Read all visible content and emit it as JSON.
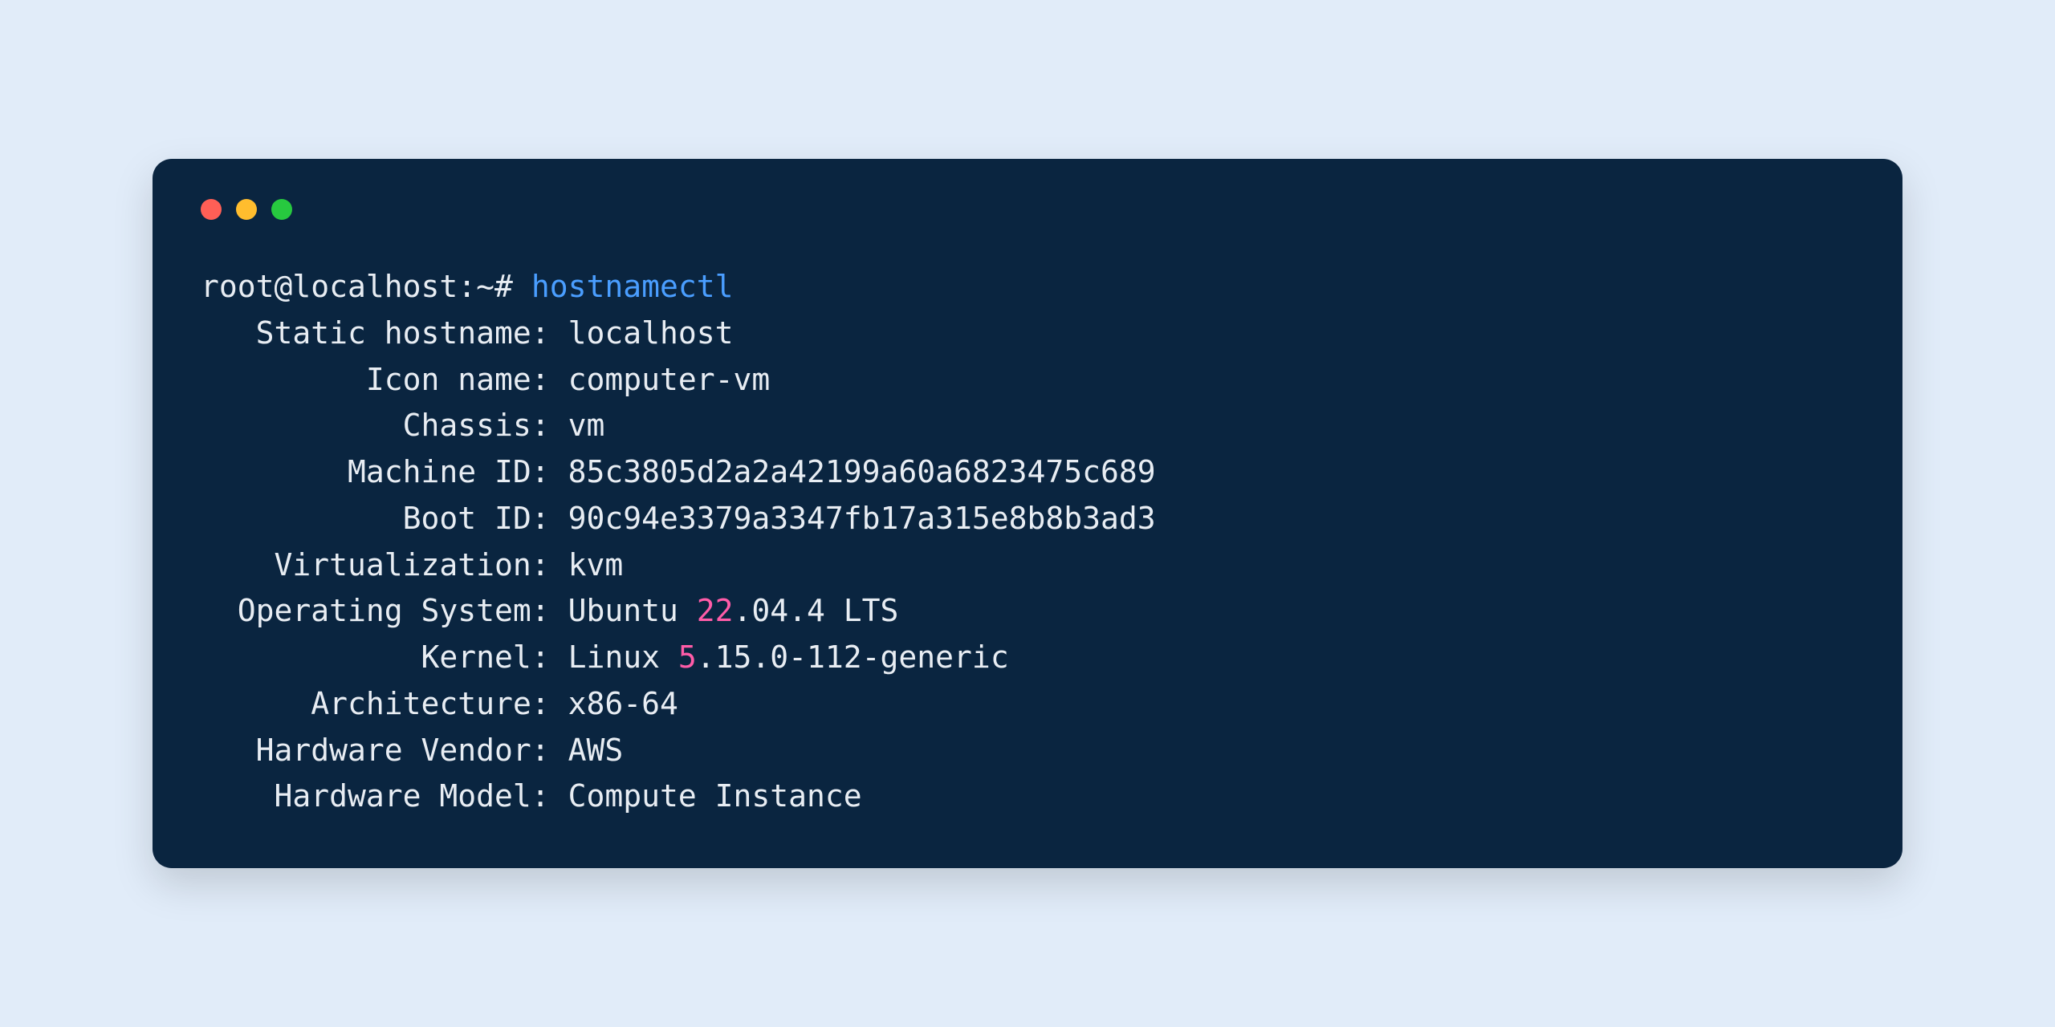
{
  "colors": {
    "background": "#e1ecf9",
    "terminal": "#0a2540",
    "text": "#e8edf3",
    "command": "#4a9eff",
    "highlight": "#ff5ca8",
    "traffic_red": "#ff5f56",
    "traffic_yellow": "#ffbd2e",
    "traffic_green": "#27c93f"
  },
  "prompt": "root@localhost:~#",
  "command": "hostnamectl",
  "rows": {
    "static_hostname": {
      "label": "Static hostname:",
      "value": "localhost"
    },
    "icon_name": {
      "label": "Icon name:",
      "value": "computer-vm"
    },
    "chassis": {
      "label": "Chassis:",
      "value": "vm"
    },
    "machine_id": {
      "label": "Machine ID:",
      "value": "85c3805d2a2a42199a60a6823475c689"
    },
    "boot_id": {
      "label": "Boot ID:",
      "value": "90c94e3379a3347fb17a315e8b8b3ad3"
    },
    "virtualization": {
      "label": "Virtualization:",
      "value": "kvm"
    },
    "operating_system": {
      "label": "Operating System:",
      "value_prefix": "Ubuntu ",
      "highlight": "22",
      "value_suffix": ".04.4 LTS"
    },
    "kernel": {
      "label": "Kernel:",
      "value_prefix": "Linux ",
      "highlight": "5",
      "value_suffix": ".15.0-112-generic"
    },
    "architecture": {
      "label": "Architecture:",
      "value": "x86-64"
    },
    "hardware_vendor": {
      "label": "Hardware Vendor:",
      "value": "AWS"
    },
    "hardware_model": {
      "label": "Hardware Model:",
      "value": "Compute Instance"
    }
  },
  "padding": {
    "static_hostname": "   ",
    "icon_name": "         ",
    "chassis": "           ",
    "machine_id": "        ",
    "boot_id": "           ",
    "virtualization": "    ",
    "operating_system": "  ",
    "kernel": "            ",
    "architecture": "      ",
    "hardware_vendor": "   ",
    "hardware_model": "    "
  }
}
